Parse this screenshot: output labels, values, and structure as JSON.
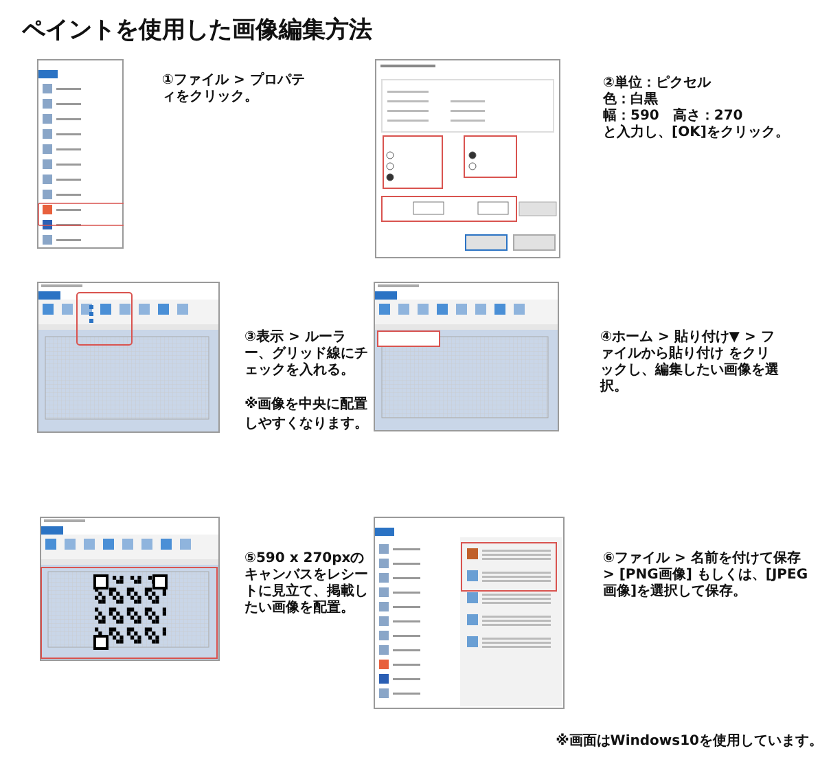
{
  "title": "ペイントを使用した画像編集方法",
  "steps": [
    {
      "kind": "file-menu",
      "text": "①ファイル > プロパティをクリック。"
    },
    {
      "kind": "properties-dialog",
      "lines": [
        "②単位：ピクセル",
        "色：白黒",
        "幅：590　高さ：270",
        "と入力し、[OK]をクリック。"
      ]
    },
    {
      "kind": "view-ribbon",
      "text": "③表示 > ルーラー、グリッド線にチェックを入れる。",
      "note": "※画像を中央に配置しやすくなります。"
    },
    {
      "kind": "home-ribbon",
      "text": "④ホーム > 貼り付け▼ > ファイルから貼り付け をクリックし、編集したい画像を選択。"
    },
    {
      "kind": "qr-canvas",
      "text": "⑤590 x 270pxのキャンバスをレシートに見立て、掲載したい画像を配置。"
    },
    {
      "kind": "save-menu",
      "text": "⑥ファイル > 名前を付けて保存 > [PNG画像] もしくは、[JPEG画像]を選択して保存。"
    }
  ],
  "footnote": "※画面はWindows10を使用しています。"
}
